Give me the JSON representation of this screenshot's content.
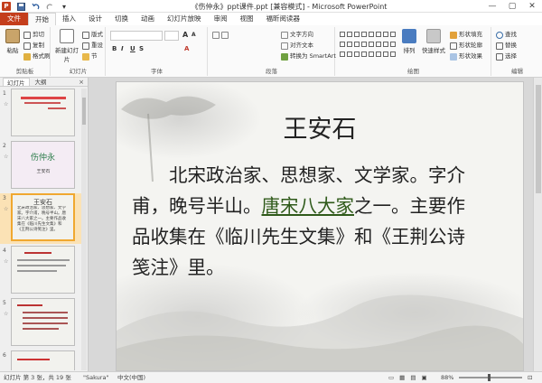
{
  "titlebar": {
    "app_icon": "P",
    "save_icon": "save-icon",
    "undo_icon": "undo-icon",
    "redo_icon": "redo-icon",
    "title": "《伤仲永》ppt课件.ppt [兼容模式] - Microsoft PowerPoint",
    "controls": [
      "—",
      "▢",
      "✕"
    ]
  },
  "tabs": [
    "文件",
    "开始",
    "插入",
    "设计",
    "切换",
    "动画",
    "幻灯片放映",
    "审阅",
    "视图",
    "福昕阅读器"
  ],
  "ribbon": {
    "clipboard": {
      "paste": "粘贴",
      "cut": "剪切",
      "copy": "复制",
      "format_painter": "格式刷",
      "label": "剪贴板"
    },
    "slides": {
      "new_slide": "新建幻灯片",
      "layout": "版式",
      "reset": "重设",
      "section": "节",
      "label": "幻灯片"
    },
    "font": {
      "font_size": "",
      "label": "字体",
      "bold": "B",
      "italic": "I",
      "underline": "U",
      "strike": "S",
      "aa_large": "A",
      "aa_small": "A"
    },
    "paragraph": {
      "text_direction": "文字方向",
      "align_text": "对齐文本",
      "smartart": "转换为 SmartArt",
      "label": "段落"
    },
    "drawing": {
      "arrange": "排列",
      "quick_styles": "快速样式",
      "shape_fill": "形状填充",
      "shape_outline": "形状轮廓",
      "shape_effects": "形状效果",
      "label": "绘图"
    },
    "editing": {
      "find": "查找",
      "replace": "替换",
      "select": "选择",
      "label": "编辑"
    }
  },
  "pane": {
    "tabs": [
      "幻灯片",
      "大纲"
    ],
    "close": "×",
    "thumbs": [
      {
        "num": "1",
        "title": "",
        "text": ""
      },
      {
        "num": "2",
        "title": "伤仲永",
        "text": "王安石"
      },
      {
        "num": "3",
        "title": "王安石",
        "text": "北宋政治家、思想家、文学家。字介甫，晚号半山。唐宋八大家之一。主要作品收集在《临川先生文集》和《王荆公诗笺注》里。"
      },
      {
        "num": "4",
        "title": "",
        "text": ""
      },
      {
        "num": "5",
        "title": "",
        "text": ""
      },
      {
        "num": "6",
        "title": "",
        "text": ""
      }
    ]
  },
  "slide": {
    "title": "王安石",
    "body_before": "北宋政治家、思想家、文学家。字介甫，晚号半山。",
    "body_link": "唐宋八大家",
    "body_after": "之一。主要作品收集在《临川先生文集》和《王荆公诗笺注》里。"
  },
  "status": {
    "slide_info": "幻灯片 第 3 张，共 19 张",
    "theme": "\"Sakura\"",
    "language": "中文(中国)",
    "zoom": "88%"
  }
}
